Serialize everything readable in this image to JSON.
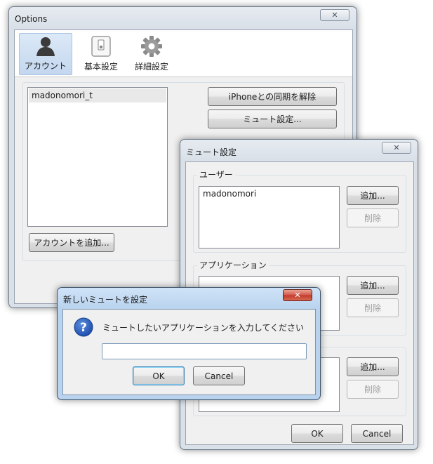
{
  "options_window": {
    "title": "Options",
    "toolbar": [
      {
        "label": "アカウント",
        "icon": "user-icon"
      },
      {
        "label": "基本設定",
        "icon": "switch-icon"
      },
      {
        "label": "詳細設定",
        "icon": "gear-icon"
      }
    ],
    "accounts": [
      "madonomori_t"
    ],
    "unsync_button": "iPhoneとの同期を解除",
    "mute_settings_button": "ミュート設定...",
    "add_account_button": "アカウントを追加..."
  },
  "mute_window": {
    "title": "ミュート設定",
    "user_group": {
      "label": "ユーザー",
      "items": [
        "madonomori"
      ],
      "add": "追加...",
      "delete": "削除"
    },
    "app_group": {
      "label": "アプリケーション",
      "add": "追加...",
      "delete": "削除"
    },
    "third_group": {
      "add": "追加...",
      "delete": "削除"
    },
    "ok": "OK",
    "cancel": "Cancel"
  },
  "prompt_dialog": {
    "title": "新しいミュートを設定",
    "message": "ミュートしたいアプリケーションを入力してください",
    "input_value": "",
    "ok": "OK",
    "cancel": "Cancel"
  },
  "close_glyph": "✕"
}
